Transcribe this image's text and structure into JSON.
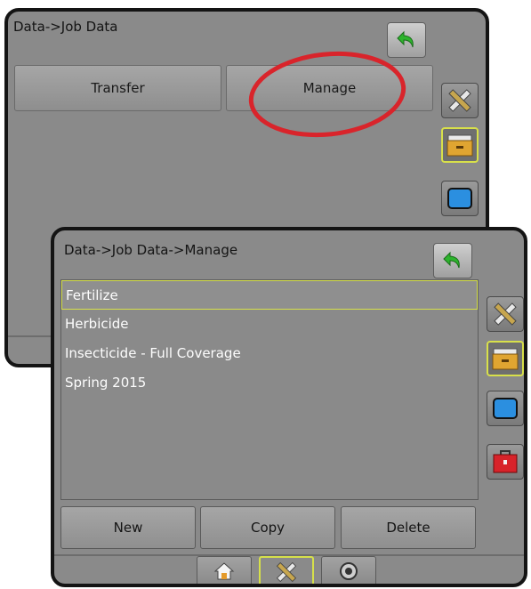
{
  "back_window": {
    "breadcrumb": "Data->Job Data",
    "tabs": [
      {
        "label": "Transfer"
      },
      {
        "label": "Manage"
      }
    ],
    "side_icons": [
      "tools-icon",
      "folder-icon",
      "screen-icon"
    ],
    "highlight_color": "#d9242b"
  },
  "front_window": {
    "breadcrumb": "Data->Job Data->Manage",
    "jobs": [
      {
        "label": "Fertilize",
        "selected": true
      },
      {
        "label": "Herbicide",
        "selected": false
      },
      {
        "label": "Insecticide - Full Coverage",
        "selected": false
      },
      {
        "label": "Spring 2015",
        "selected": false
      }
    ],
    "actions": {
      "new_label": "New",
      "copy_label": "Copy",
      "delete_label": "Delete"
    },
    "side_icons": [
      "tools-icon",
      "folder-icon",
      "screen-icon",
      "toolbox-icon"
    ],
    "bottom_nav": [
      "home-icon",
      "tools-icon",
      "gauge-icon"
    ],
    "accent_color": "#d6e04a"
  }
}
